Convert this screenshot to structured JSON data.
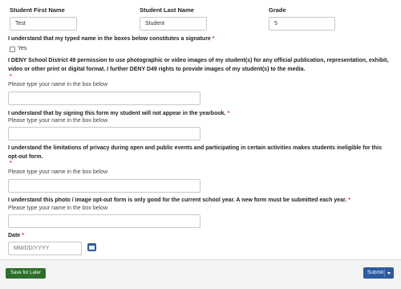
{
  "fields": {
    "first_name": {
      "label": "Student First Name",
      "value": "Test"
    },
    "last_name": {
      "label": "Student Last Name",
      "value": "Student"
    },
    "grade": {
      "label": "Grade",
      "value": "5"
    }
  },
  "signature_ack": {
    "question": "I understand that my typed name in the boxes below constitutes a signature",
    "required_mark": "*",
    "option_label": "Yes"
  },
  "q1": {
    "question": "I DENY School District 49 permission to use photographic or video images of my student(s) for any official publication, representation, exhibit, video or other print or digital format. I further DENY D49 rights to provide images of my student(s) to the media.",
    "required_mark": "*",
    "hint": "Please type your name in the box below"
  },
  "q2": {
    "question": "I understand that by signing this form my student will not appear in the yearbook.",
    "required_mark": "*",
    "hint": "Please type your name in the box below"
  },
  "q3": {
    "question": "I understand the limitations of privacy during open and public events and participating in certain activities makes students ineligible for this opt-out form.",
    "required_mark": "*",
    "hint": "Please type your name in the box below"
  },
  "q4": {
    "question": "I understand this photo / image opt-out form is only good for the current school year. A new form must be submitted each year.",
    "required_mark": "*",
    "hint": "Please type your name in the box below"
  },
  "date": {
    "label": "Date",
    "required_mark": "*",
    "placeholder": "MM/DD/YYYY"
  },
  "footer": {
    "save_label": "Save for Later",
    "submit_label": "Submit"
  },
  "colors": {
    "required": "#d9332e",
    "save_button": "#2e6e2c",
    "submit_button": "#2c5b9f"
  }
}
